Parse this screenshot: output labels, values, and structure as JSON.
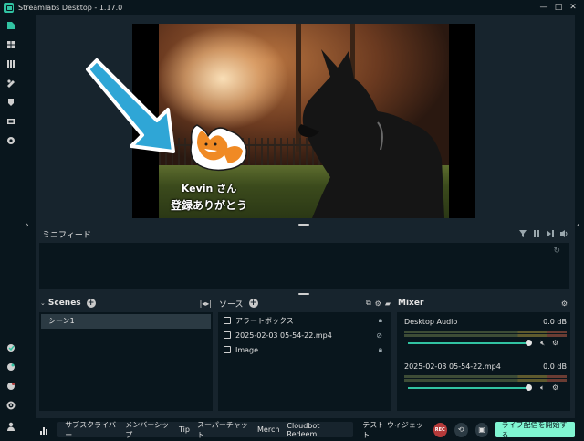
{
  "window": {
    "title": "Streamlabs Desktop - 1.17.0",
    "minimize": "—",
    "maximize": "□",
    "close": "✕"
  },
  "nav": {
    "icons": [
      "editor-icon",
      "themes-icon",
      "library-icon",
      "tools-icon",
      "highlighter-icon",
      "studio-mode-icon",
      "record-icon"
    ],
    "bottom_icons": [
      "integration-icon",
      "golive-icon",
      "alert-icon",
      "settings-icon",
      "profile-icon"
    ]
  },
  "overlay": {
    "name": "Kevin さん",
    "message": "登録ありがとう"
  },
  "minifeed": {
    "label": "ミニフィード"
  },
  "scenes": {
    "title": "Scenes",
    "items": [
      "シーン1"
    ]
  },
  "sources": {
    "title": "ソース",
    "items": [
      {
        "name": "アラートボックス",
        "icon": "alertbox-icon"
      },
      {
        "name": "2025-02-03 05-54-22.mp4",
        "icon": "media-icon"
      },
      {
        "name": "Image",
        "icon": "image-icon"
      }
    ]
  },
  "mixer": {
    "title": "Mixer",
    "channels": [
      {
        "name": "Desktop Audio",
        "level": "0.0 dB",
        "volume": 1.0
      },
      {
        "name": "2025-02-03 05-54-22.mp4",
        "level": "0.0 dB",
        "volume": 1.0
      }
    ]
  },
  "footer": {
    "links": [
      "サブスクライバー",
      "メンバーシップ",
      "Tip",
      "スーパーチャット",
      "Merch",
      "Cloudbot Redeem"
    ],
    "test_widgets": "テスト ウィジェット",
    "rec": "REC",
    "golive": "ライブ配信を開始する"
  },
  "colors": {
    "accent": "#31c3a2",
    "golive": "#80f5d2",
    "bg_dark": "#09161d",
    "bg": "#17242d",
    "rec": "#b53a3a"
  }
}
